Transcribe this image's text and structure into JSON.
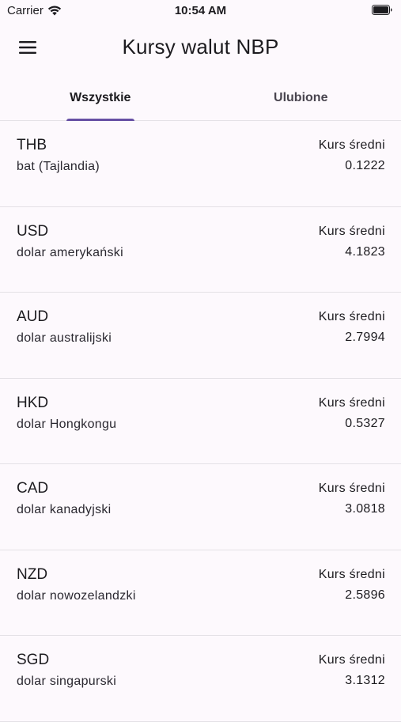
{
  "status_bar": {
    "carrier": "Carrier",
    "time": "10:54 AM",
    "icons": [
      "wifi-icon",
      "battery-icon"
    ]
  },
  "app_bar": {
    "title": "Kursy walut NBP",
    "menu_icon": "hamburger-menu-icon"
  },
  "tabs": [
    {
      "label": "Wszystkie",
      "active": true
    },
    {
      "label": "Ulubione",
      "active": false
    }
  ],
  "colors": {
    "accent": "#6750a4",
    "background": "#fdf9fd",
    "divider": "#e4e1e6"
  },
  "currencies": [
    {
      "code": "THB",
      "name": "bat (Tajlandia)",
      "rate_label": "Kurs średni",
      "rate": "0.1222"
    },
    {
      "code": "USD",
      "name": "dolar amerykański",
      "rate_label": "Kurs średni",
      "rate": "4.1823"
    },
    {
      "code": "AUD",
      "name": "dolar australijski",
      "rate_label": "Kurs średni",
      "rate": "2.7994"
    },
    {
      "code": "HKD",
      "name": "dolar Hongkongu",
      "rate_label": "Kurs średni",
      "rate": "0.5327"
    },
    {
      "code": "CAD",
      "name": "dolar kanadyjski",
      "rate_label": "Kurs średni",
      "rate": "3.0818"
    },
    {
      "code": "NZD",
      "name": "dolar nowozelandzki",
      "rate_label": "Kurs średni",
      "rate": "2.5896"
    },
    {
      "code": "SGD",
      "name": "dolar singapurski",
      "rate_label": "Kurs średni",
      "rate": "3.1312"
    }
  ]
}
